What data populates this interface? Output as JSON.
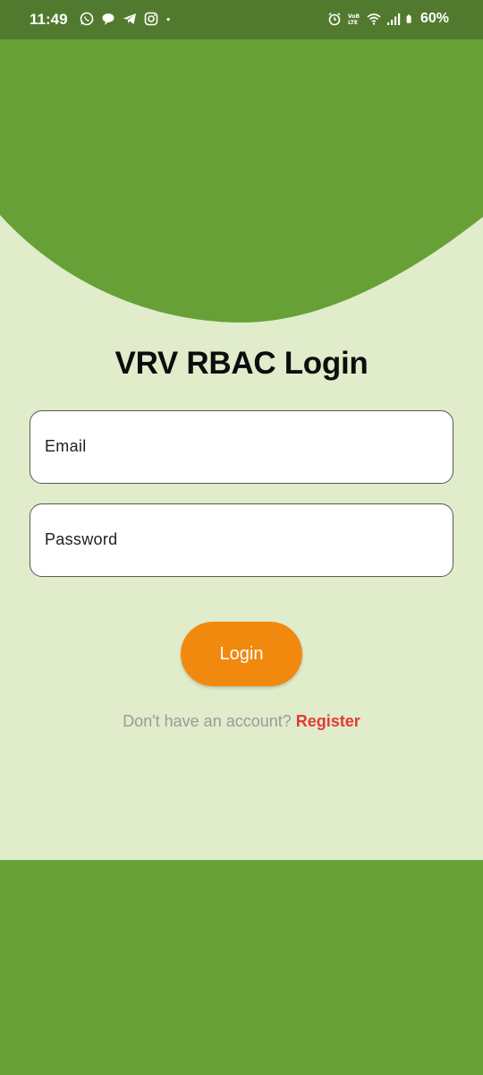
{
  "status_bar": {
    "time": "11:49",
    "battery": "60%",
    "left_icons": [
      "whatsapp-icon",
      "chat-bubble-icon",
      "telegram-icon",
      "instagram-icon",
      "dot-icon"
    ],
    "right_icons": [
      "alarm-icon",
      "volte-icon",
      "wifi-icon",
      "signal-icon",
      "battery-icon"
    ]
  },
  "login": {
    "title": "VRV RBAC Login",
    "email_label": "Email",
    "password_label": "Password",
    "login_button": "Login",
    "register_prompt": "Don't have an account?",
    "register_link": "Register"
  },
  "colors": {
    "header_green": "#68a038",
    "status_bar": "#527a2e",
    "background": "#e0ecca",
    "button_orange": "#f2890f",
    "register_red": "#e53935"
  }
}
